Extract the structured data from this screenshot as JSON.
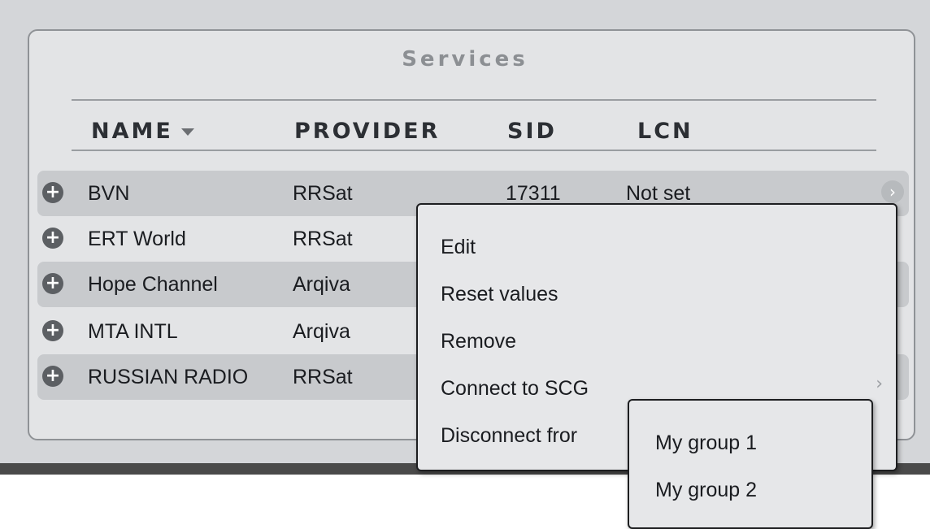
{
  "panel": {
    "title": "Services"
  },
  "columns": {
    "name": "NAME",
    "provider": "PROVIDER",
    "sid": "SID",
    "lcn": "LCN"
  },
  "rows": [
    {
      "name": "BVN",
      "provider": "RRSat",
      "sid": "17311",
      "lcn": "Not set"
    },
    {
      "name": "ERT World",
      "provider": "RRSat",
      "sid": "",
      "lcn": ""
    },
    {
      "name": "Hope Channel",
      "provider": "Arqiva",
      "sid": "",
      "lcn": ""
    },
    {
      "name": "MTA INTL",
      "provider": "Arqiva",
      "sid": "",
      "lcn": ""
    },
    {
      "name": "RUSSIAN RADIO",
      "provider": "RRSat",
      "sid": "",
      "lcn": ""
    }
  ],
  "context_menu": {
    "items": [
      "Edit",
      "Reset values",
      "Remove",
      "Connect to SCG",
      "Disconnect fror"
    ]
  },
  "submenu": {
    "items": [
      "My group 1",
      "My group 2"
    ]
  },
  "icons": {
    "row_add": "plus-circle-icon",
    "row_detail": "chevron-circle-icon",
    "sort": "sort-descending-icon",
    "submenu": "chevron-right-icon"
  },
  "colors": {
    "panel_bg": "#d4d6d9",
    "row_shaded": "#c8cacd",
    "menu_bg": "#e6e7e9",
    "title_text": "#8c8f93"
  }
}
